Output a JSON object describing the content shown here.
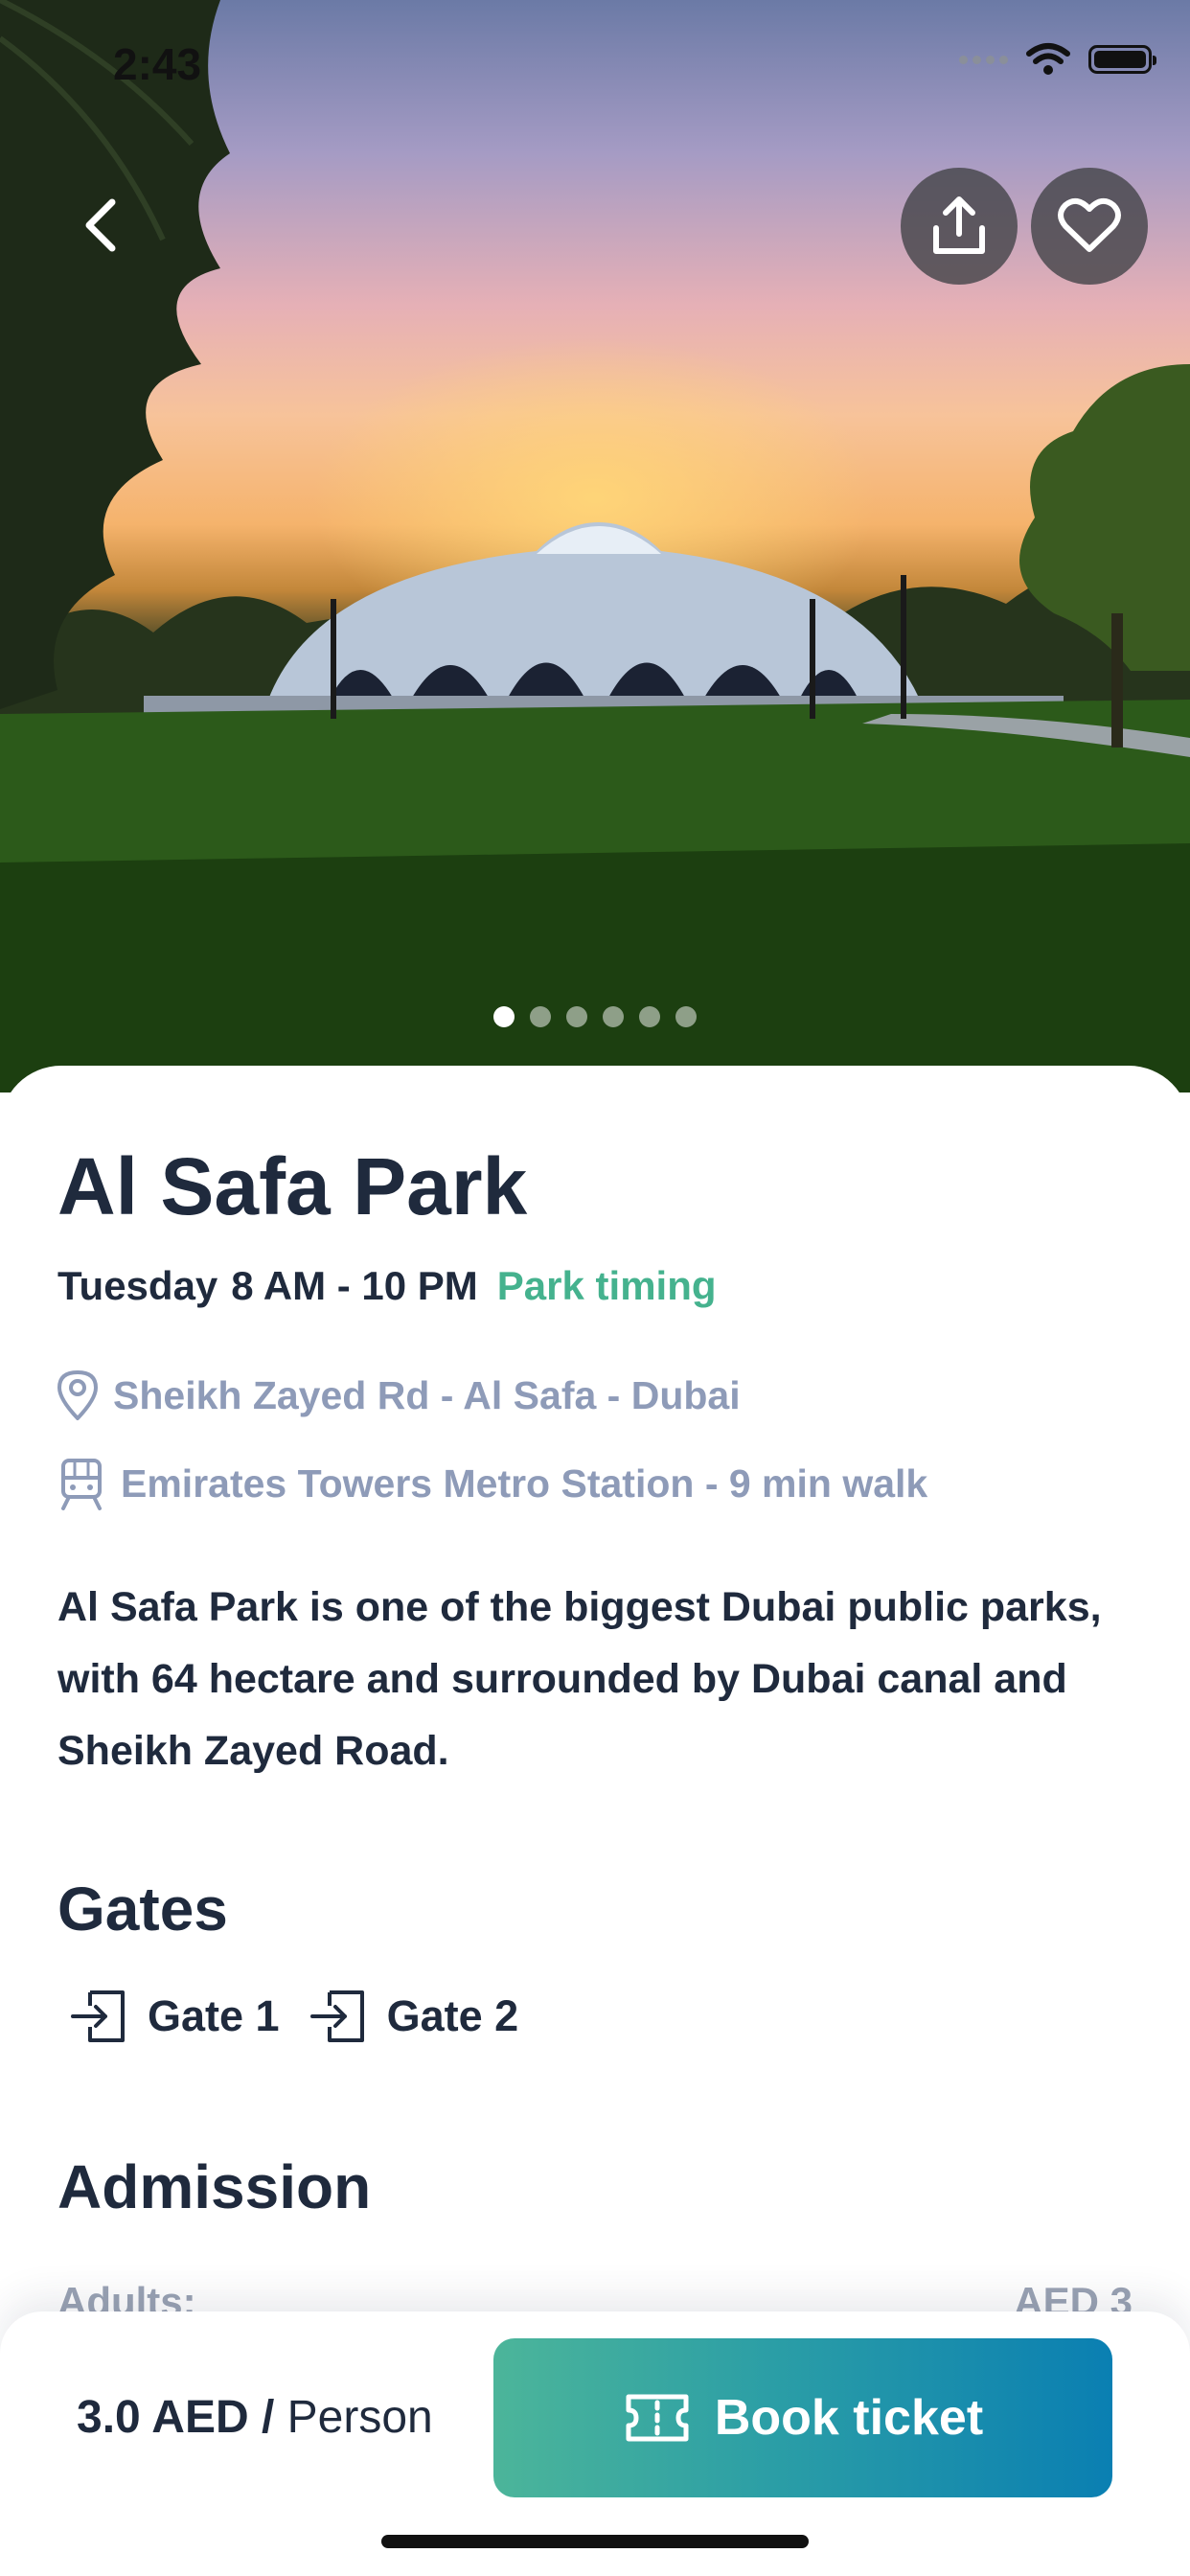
{
  "status_bar": {
    "time": "2:43"
  },
  "hero": {
    "back_icon": "chevron-left-icon",
    "share_icon": "share-upload-icon",
    "favorite_icon": "heart-outline-icon",
    "carousel": {
      "count": 6,
      "active_index": 0
    }
  },
  "park": {
    "title": "Al Safa Park",
    "timing": {
      "day": "Tuesday",
      "hours": "8 AM - 10 PM",
      "label": "Park timing"
    },
    "address": "Sheikh Zayed Rd - Al Safa - Dubai",
    "metro": "Emirates Towers Metro Station - 9 min walk",
    "description": "Al Safa Park is one of the biggest Dubai public parks, with 64 hectare and surrounded by Dubai canal and Sheikh Zayed Road."
  },
  "gates": {
    "title": "Gates",
    "items": [
      {
        "label": "Gate 1"
      },
      {
        "label": "Gate 2"
      }
    ]
  },
  "admission": {
    "title": "Admission",
    "rows": [
      {
        "label": "Adults:",
        "price": "AED 3"
      }
    ]
  },
  "footer": {
    "price_amount": "3.0 AED / ",
    "price_unit": "Person",
    "book_label": "Book ticket"
  },
  "colors": {
    "primary_text": "#1f2a3d",
    "accent_green": "#45b28e",
    "muted": "#8e9bb8",
    "button_gradient_start": "#4cb59a",
    "button_gradient_end": "#0a7fb2"
  }
}
